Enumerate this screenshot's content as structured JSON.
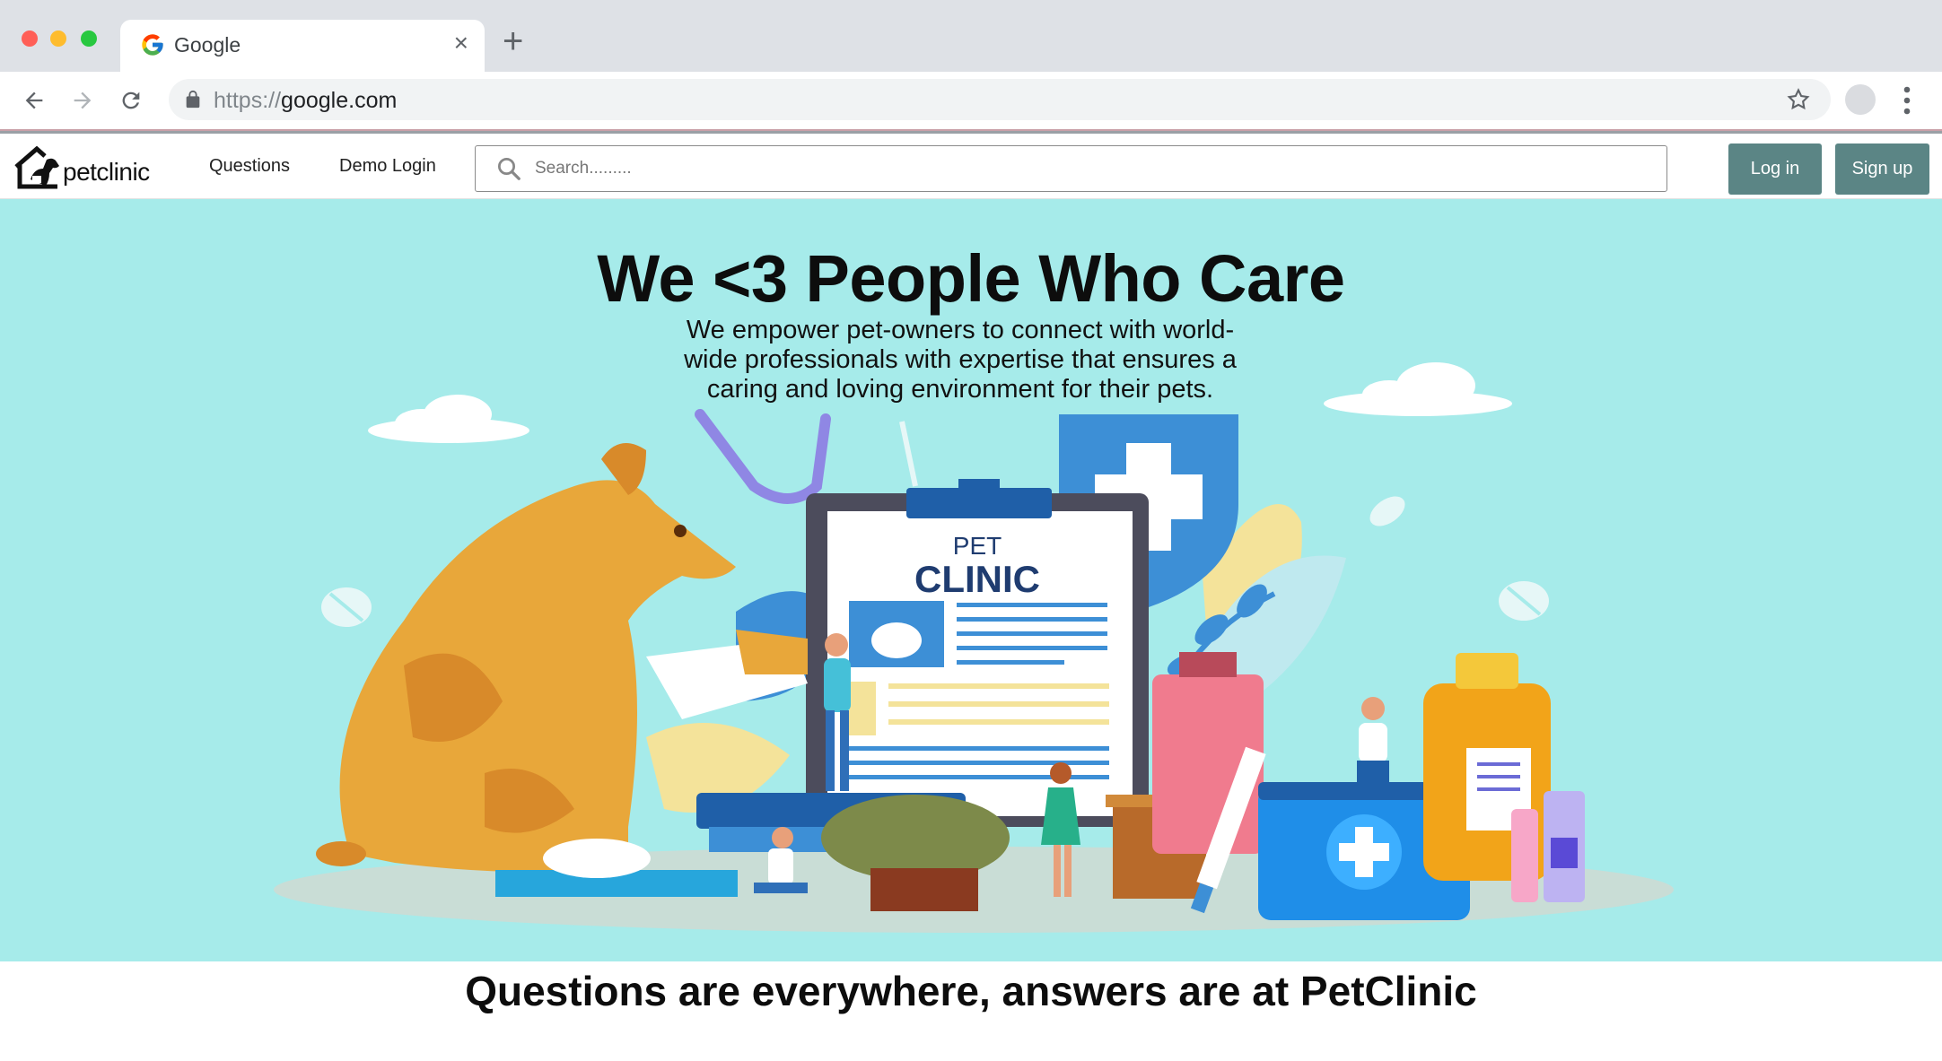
{
  "browser": {
    "tab_title": "Google",
    "tab_close_glyph": "×",
    "new_tab_glyph": "+",
    "url_scheme": "https://",
    "url_host": "google.com",
    "icons": [
      "back-icon",
      "forward-icon",
      "reload-icon",
      "lock-icon",
      "star-icon",
      "profile-avatar",
      "menu-icon"
    ]
  },
  "navbar": {
    "logo_text": "petclinic",
    "links": [
      {
        "label": "Questions"
      },
      {
        "label": "Demo Login"
      }
    ],
    "search_placeholder": "Search.........",
    "login_label": "Log in",
    "signup_label": "Sign up",
    "button_color": "#5b8585"
  },
  "hero": {
    "title": "We <3 People Who Care",
    "subtitle": "We empower pet-owners to connect with world-wide professionals with expertise that ensures a caring and loving environment for their pets.",
    "background_color": "#a6ebea",
    "illustration": {
      "clipboard_line1": "PET",
      "clipboard_line2": "CLINIC"
    }
  },
  "tagline": "Questions are everywhere, answers are at PetClinic"
}
